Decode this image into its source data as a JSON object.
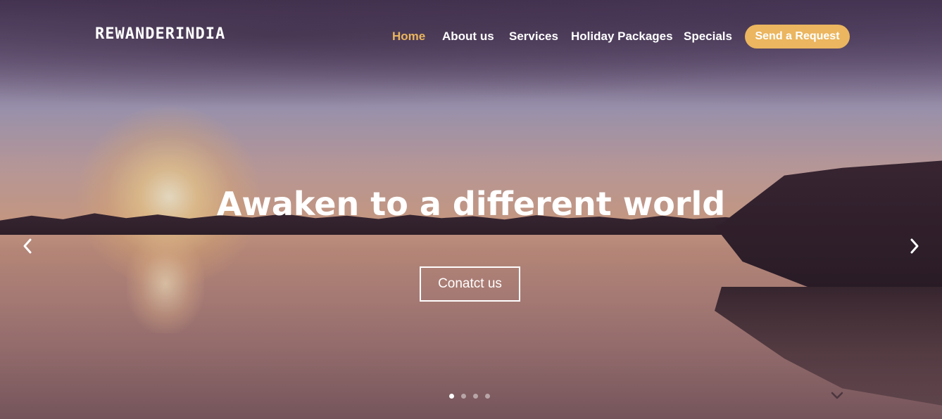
{
  "brand": {
    "logo_text": "REWANDERINDIA"
  },
  "nav": {
    "items": [
      {
        "label": "Home",
        "active": true
      },
      {
        "label": "About us",
        "active": false
      },
      {
        "label": "Services",
        "active": false
      },
      {
        "label": "Holiday Packages",
        "active": false
      },
      {
        "label": "Specials",
        "active": false
      }
    ],
    "request_button_label": "Send a Request"
  },
  "hero": {
    "headline": "Awaken to a different world",
    "contact_button_label": "Conatct us",
    "slide_count": 4,
    "active_slide": 1,
    "prev_icon": "chevron-left-icon",
    "next_icon": "chevron-right-icon"
  },
  "colors": {
    "accent": "#ebb65f",
    "active_nav": "#eab55e",
    "text": "#ffffff"
  }
}
